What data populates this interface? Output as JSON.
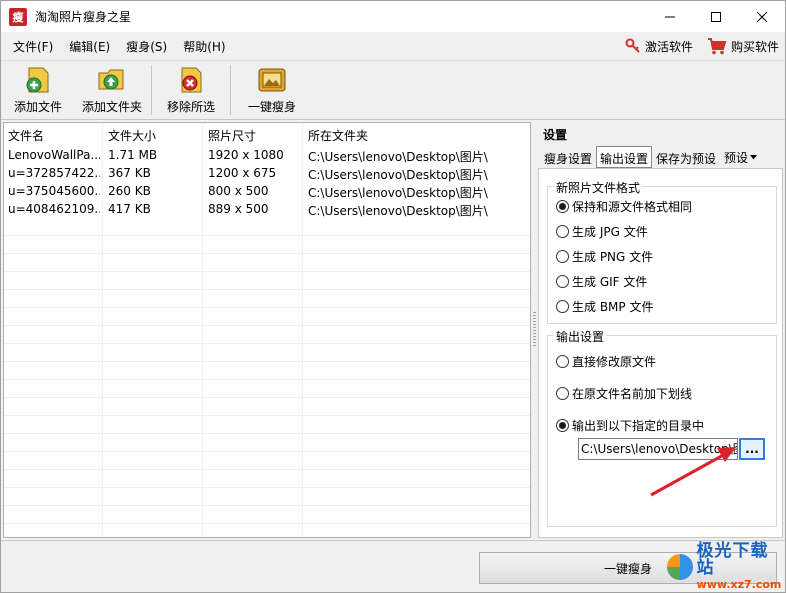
{
  "window": {
    "app_icon_char": "瘦",
    "title": "淘淘照片瘦身之星",
    "controls": [
      "minimize",
      "maximize",
      "close"
    ]
  },
  "menu": {
    "items": [
      "文件(F)",
      "编辑(E)",
      "瘦身(S)",
      "帮助(H)"
    ],
    "activate": "激活软件",
    "buy": "购买软件"
  },
  "toolbar": {
    "add_file": "添加文件",
    "add_folder": "添加文件夹",
    "remove_selected": "移除所选",
    "one_click": "一键瘦身"
  },
  "file_list": {
    "columns": [
      "文件名",
      "文件大小",
      "照片尺寸",
      "所在文件夹"
    ],
    "rows": [
      [
        "LenovoWallPa...",
        "1.71 MB",
        "1920 x 1080",
        "C:\\Users\\lenovo\\Desktop\\图片\\"
      ],
      [
        "u=372857422...",
        "367 KB",
        "1200 x 675",
        "C:\\Users\\lenovo\\Desktop\\图片\\"
      ],
      [
        "u=375045600...",
        "260 KB",
        "800 x 500",
        "C:\\Users\\lenovo\\Desktop\\图片\\"
      ],
      [
        "u=408462109...",
        "417 KB",
        "889 x 500",
        "C:\\Users\\lenovo\\Desktop\\图片\\"
      ]
    ]
  },
  "settings": {
    "title": "设置",
    "tabs": [
      "瘦身设置",
      "输出设置",
      "保存为预设",
      "预设"
    ],
    "active_tab": "输出设置",
    "format_group": {
      "label": "新照片文件格式",
      "options": [
        "保持和源文件格式相同",
        "生成 JPG 文件",
        "生成 PNG 文件",
        "生成 GIF 文件",
        "生成 BMP 文件"
      ],
      "selected_index": 0
    },
    "output_group": {
      "label": "输出设置",
      "options": [
        "直接修改原文件",
        "在原文件名前加下划线",
        "输出到以下指定的目录中"
      ],
      "selected_index": 2,
      "path_value": "C:\\Users\\lenovo\\Desktop\\图片",
      "browse_label": "..."
    }
  },
  "bottom": {
    "run_button": "一键瘦身"
  },
  "watermark": {
    "title": "极光下载站",
    "url": "www.xz7.com"
  },
  "colors": {
    "annotation_arrow": "#d9232a",
    "focus_blue": "#2b7de0"
  }
}
